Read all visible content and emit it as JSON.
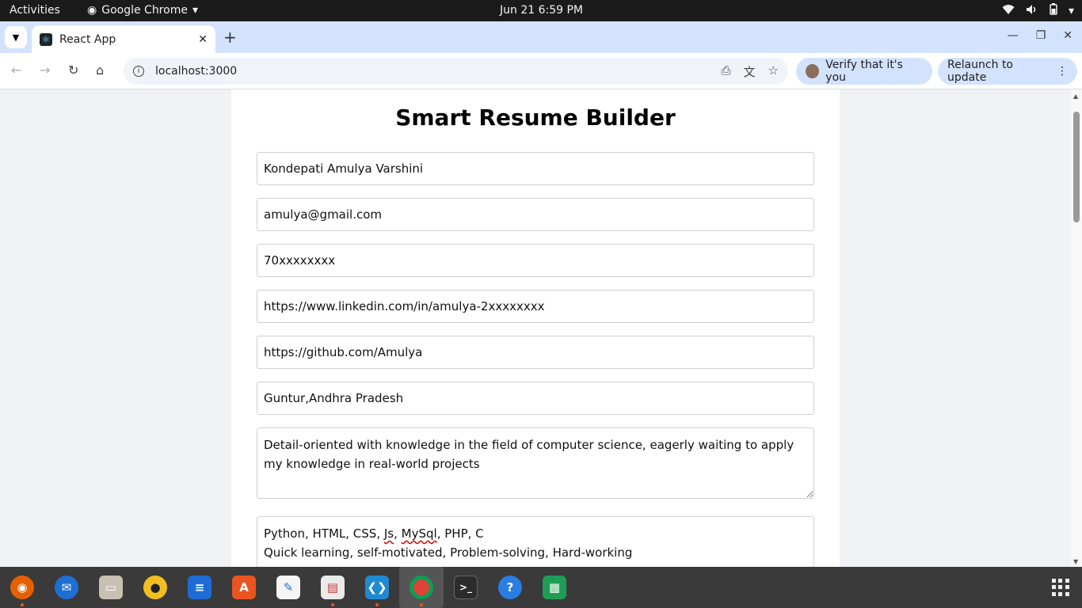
{
  "topbar": {
    "activities": "Activities",
    "app_name": "Google Chrome",
    "clock": "Jun 21   6:59 PM"
  },
  "browser": {
    "tab_title": "React App",
    "url": "localhost:3000",
    "verify_chip": "Verify that it's you",
    "relaunch_chip": "Relaunch to update"
  },
  "page": {
    "title": "Smart Resume Builder",
    "fields": {
      "name": "Kondepati Amulya Varshini",
      "email": "amulya@gmail.com",
      "phone": "70xxxxxxxx",
      "linkedin": "https://www.linkedin.com/in/amulya-2xxxxxxxx",
      "github": "https://github.com/Amulya",
      "location": "Guntur,Andhra Pradesh",
      "summary": "Detail-oriented with knowledge in the field of computer science, eagerly waiting to apply my knowledge in real-world projects",
      "skills_line1_a": "Python, HTML, CSS, ",
      "skills_js": "Js",
      "skills_sep": ", ",
      "skills_mysql": "MySql",
      "skills_line1_b": ", PHP, C",
      "skills_line2": "Quick learning, self-motivated, Problem-solving, Hard-working"
    }
  },
  "dock": {
    "apps": [
      "firefox-icon",
      "thunderbird-icon",
      "files-icon",
      "rhythmbox-icon",
      "writer-icon",
      "app-center-icon",
      "text-editor-icon",
      "document-viewer-icon",
      "vscode-icon",
      "chrome-icon",
      "terminal-icon",
      "help-icon",
      "calc-icon"
    ]
  },
  "colors": {
    "tabstrip": "#d3e3fd",
    "topbar": "#1b1b1b",
    "page_bg": "#f0f2f5",
    "dock": "#3a3a3a"
  }
}
